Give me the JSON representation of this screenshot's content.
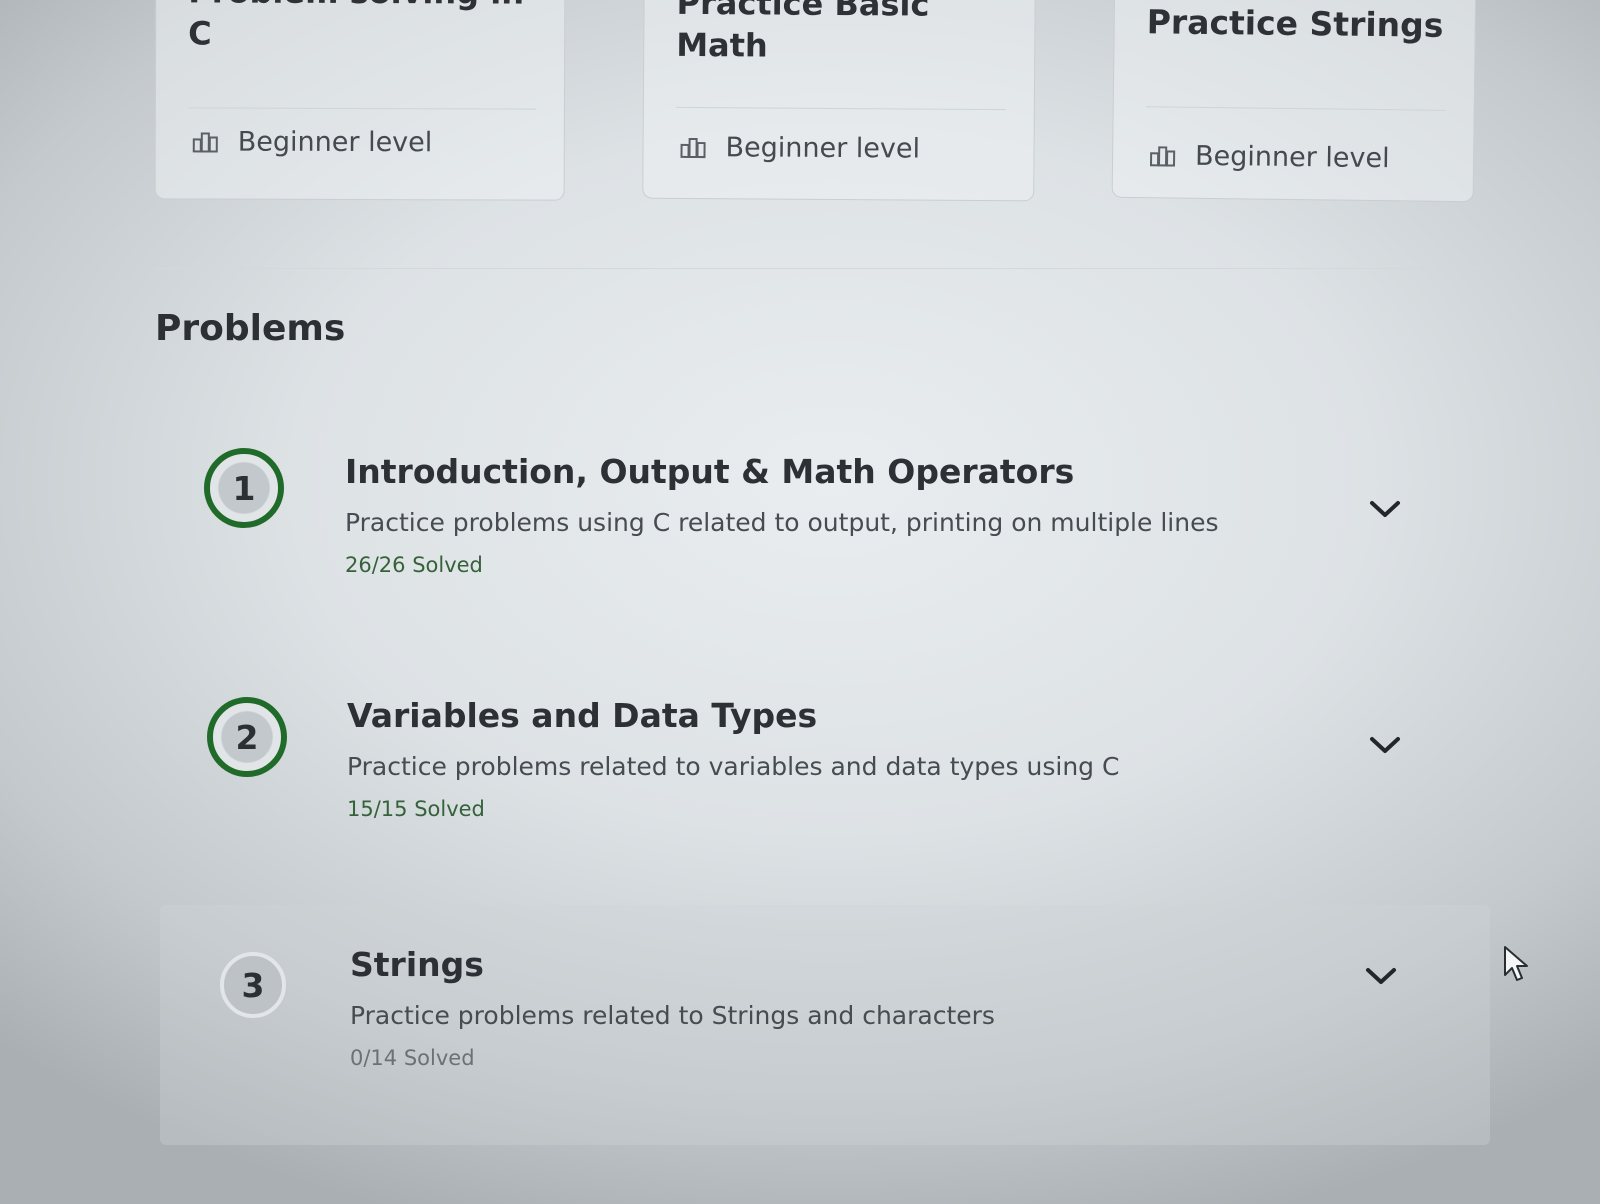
{
  "course_cards": [
    {
      "title": "Problem solving in C",
      "level": "Beginner level",
      "level_icon": "bar-chart-icon"
    },
    {
      "title": "Practice Basic Math",
      "level": "Beginner level",
      "level_icon": "bar-chart-icon"
    },
    {
      "title": "Practice Strings",
      "level": "Beginner level",
      "level_icon": "bar-chart-icon"
    }
  ],
  "problems": {
    "heading": "Problems",
    "items": [
      {
        "number": "1",
        "title": "Introduction, Output & Math Operators",
        "description": "Practice problems using C related to output, printing on multiple lines",
        "solved": "26/26 Solved",
        "status": "completed",
        "expand_icon": "chevron-down-icon"
      },
      {
        "number": "2",
        "title": "Variables and Data Types",
        "description": "Practice problems related to variables and data types using C",
        "solved": "15/15 Solved",
        "status": "completed",
        "expand_icon": "chevron-down-icon"
      },
      {
        "number": "3",
        "title": "Strings",
        "description": "Practice problems related to Strings and characters",
        "solved": "0/14 Solved",
        "status": "not-started",
        "expand_icon": "chevron-down-icon"
      }
    ]
  },
  "colors": {
    "completed_ring": "#216b2a",
    "solved_text": "#35623b",
    "pending_text": "#6a7277"
  }
}
